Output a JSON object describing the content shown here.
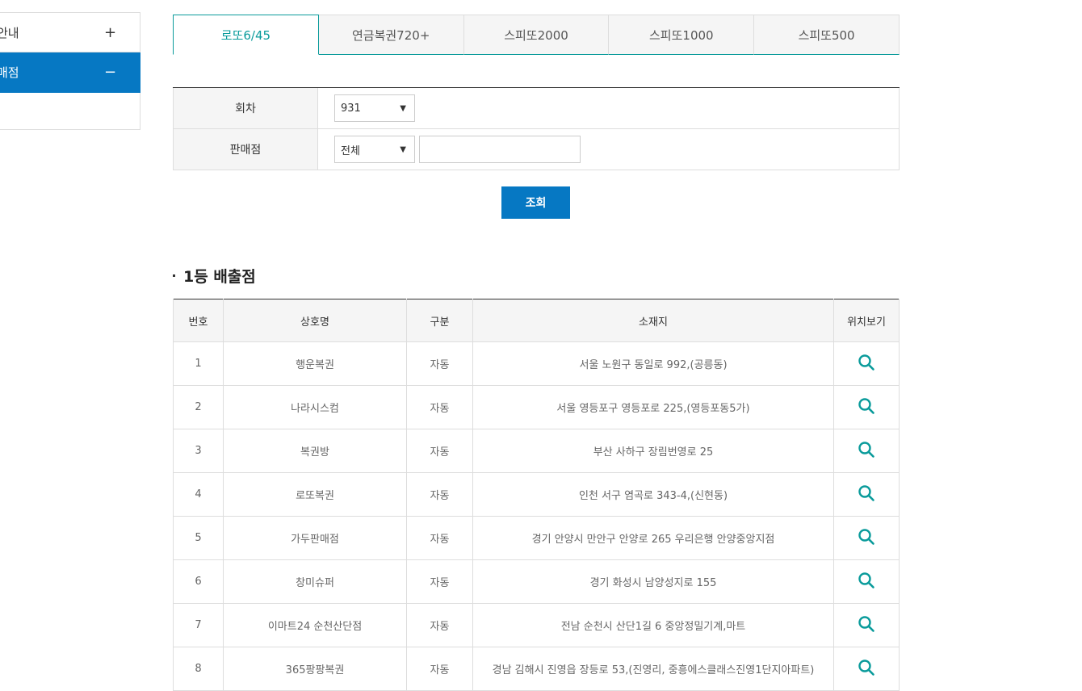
{
  "sidebar": {
    "items": [
      {
        "label": "안내",
        "sign": "+"
      },
      {
        "label": "매점",
        "sign": "−"
      }
    ]
  },
  "tabs": [
    "로또6/45",
    "연금복권720+",
    "스피또2000",
    "스피또1000",
    "스피또500"
  ],
  "search": {
    "round_label": "회차",
    "round_value": "931",
    "store_label": "판매점",
    "store_select": "전체",
    "store_input": "",
    "button": "조회"
  },
  "section_title": "1등 배출점",
  "table": {
    "headers": [
      "번호",
      "상호명",
      "구분",
      "소재지",
      "위치보기"
    ],
    "rows": [
      {
        "no": "1",
        "name": "행운복권",
        "type": "자동",
        "addr": "서울 노원구 동일로 992,(공릉동)"
      },
      {
        "no": "2",
        "name": "나라시스컴",
        "type": "자동",
        "addr": "서울 영등포구 영등포로 225,(영등포동5가)"
      },
      {
        "no": "3",
        "name": "복권방",
        "type": "자동",
        "addr": "부산 사하구 장림번영로 25"
      },
      {
        "no": "4",
        "name": "로또복권",
        "type": "자동",
        "addr": "인천 서구 염곡로 343-4,(신현동)"
      },
      {
        "no": "5",
        "name": "가두판매점",
        "type": "자동",
        "addr": "경기 안양시 만안구 안양로 265 우리은행 안양중앙지점"
      },
      {
        "no": "6",
        "name": "창미슈퍼",
        "type": "자동",
        "addr": "경기 화성시 남양성지로 155"
      },
      {
        "no": "7",
        "name": "이마트24 순천산단점",
        "type": "자동",
        "addr": "전남 순천시 산단1길 6 중앙정밀기계,마트"
      },
      {
        "no": "8",
        "name": "365팡팡복권",
        "type": "자동",
        "addr": "경남 김해시 진영읍 장등로 53,(진영리, 중흥에스클래스진영1단지아파트)"
      }
    ]
  },
  "colors": {
    "accent": "#0678c3",
    "tab_accent": "#0a9b9b",
    "icon": "#0a9b9b"
  },
  "icons": {
    "location": "search-icon"
  }
}
